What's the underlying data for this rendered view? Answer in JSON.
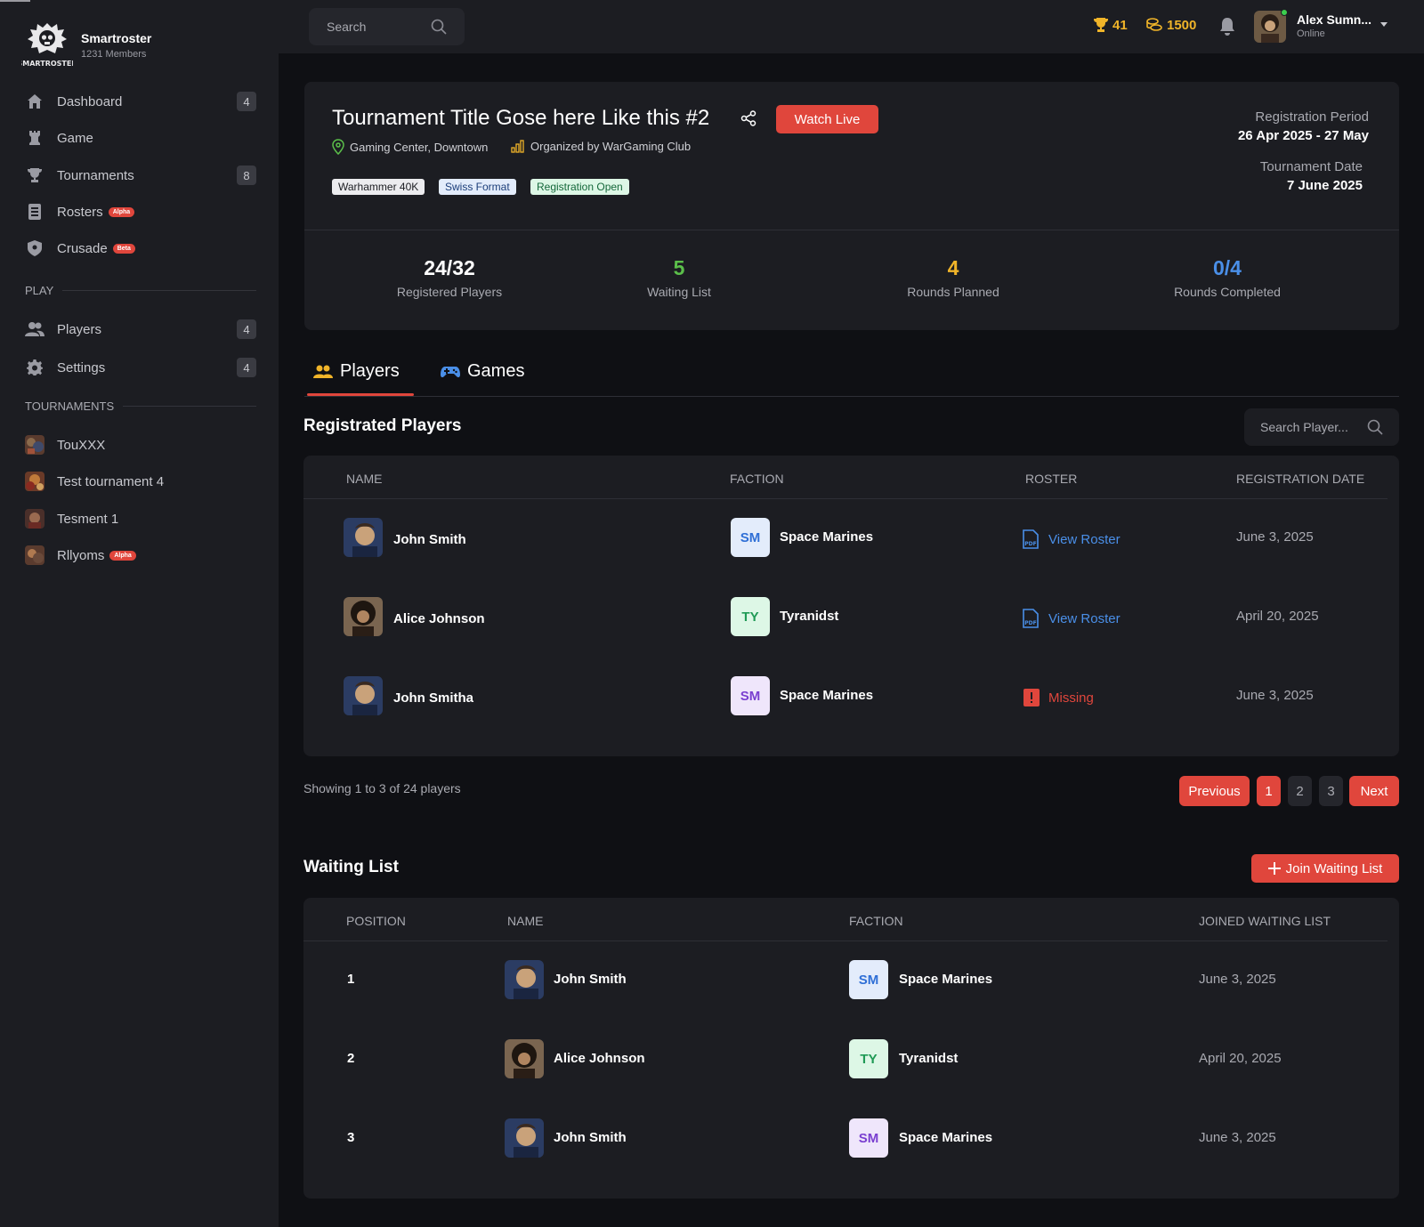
{
  "brand": {
    "name": "Smartroster",
    "members": "1231 Members",
    "logo_text": "SMARTROSTER"
  },
  "sidebar": {
    "items": [
      {
        "label": "Dashboard",
        "count": "4",
        "icon": "home-icon"
      },
      {
        "label": "Game",
        "icon": "chess-rook-icon"
      },
      {
        "label": "Tournaments",
        "count": "8",
        "icon": "trophy-icon"
      },
      {
        "label": "Rosters",
        "badge": "Alpha",
        "icon": "list-icon"
      },
      {
        "label": "Crusade",
        "badge": "Beta",
        "icon": "shield-icon"
      }
    ],
    "play_heading": "PLAY",
    "play_items": [
      {
        "label": "Players",
        "count": "4",
        "icon": "users-icon"
      },
      {
        "label": "Settings",
        "count": "4",
        "icon": "gear-icon"
      }
    ],
    "tournaments_heading": "TOURNAMENTS",
    "tournaments": [
      {
        "label": "TouXXX"
      },
      {
        "label": "Test tournament 4"
      },
      {
        "label": "Tesment 1"
      },
      {
        "label": "Rllyoms",
        "badge": "Alpha"
      }
    ]
  },
  "topbar": {
    "search_placeholder": "Search",
    "trophies": "41",
    "coins": "1500",
    "user_name": "Alex Sumn...",
    "user_status": "Online"
  },
  "tournament": {
    "title": "Tournament Title Gose here Like this #2",
    "watch_label": "Watch Live",
    "location": "Gaming Center, Downtown",
    "organizer": "Organized by WarGaming Club",
    "tags": [
      "Warhammer 40K",
      "Swiss Format",
      "Registration Open"
    ],
    "registration_period_label": "Registration Period",
    "registration_period": "26 Apr 2025 - 27 May",
    "tournament_date_label": "Tournament Date",
    "tournament_date": "7 June 2025",
    "stats": [
      {
        "value": "24/32",
        "label": "Registered Players",
        "color": "#ffffff"
      },
      {
        "value": "5",
        "label": "Waiting List",
        "color": "#5bbf4a"
      },
      {
        "value": "4",
        "label": "Rounds Planned",
        "color": "#f0b429"
      },
      {
        "value": "0/4",
        "label": "Rounds Completed",
        "color": "#4a8fe8"
      }
    ]
  },
  "tabs": [
    {
      "label": "Players",
      "active": true
    },
    {
      "label": "Games",
      "active": false
    }
  ],
  "registered": {
    "title": "Registrated Players",
    "search_placeholder": "Search Player...",
    "columns": [
      "NAME",
      "FACTION",
      "ROSTER",
      "REGISTRATION DATE"
    ],
    "rows": [
      {
        "name": "John Smith",
        "faction_code": "SM",
        "faction": "Space Marines",
        "roster": "View Roster",
        "roster_status": "ok",
        "date": "June 3, 2025"
      },
      {
        "name": "Alice Johnson",
        "faction_code": "TY",
        "faction": "Tyranidst",
        "roster": "View Roster",
        "roster_status": "ok",
        "date": "April 20, 2025"
      },
      {
        "name": "John Smitha",
        "faction_code": "SM",
        "faction": "Space Marines",
        "roster": "Missing",
        "roster_status": "missing",
        "date": "June 3, 2025"
      }
    ]
  },
  "pagination": {
    "showing": "Showing 1 to 3 of 24 players",
    "previous": "Previous",
    "pages": [
      "1",
      "2",
      "3"
    ],
    "current_page": "1",
    "next": "Next"
  },
  "waiting": {
    "title": "Waiting List",
    "join_label": "Join Waiting List",
    "columns": [
      "POSITION",
      "NAME",
      "FACTION",
      "JOINED WAITING LIST"
    ],
    "rows": [
      {
        "position": "1",
        "name": "John Smith",
        "faction_code": "SM",
        "faction": "Space Marines",
        "date": "June 3, 2025"
      },
      {
        "position": "2",
        "name": "Alice Johnson",
        "faction_code": "TY",
        "faction": "Tyranidst",
        "date": "April 20, 2025"
      },
      {
        "position": "3",
        "name": "John Smith",
        "faction_code": "SM",
        "faction": "Space Marines",
        "date": "June 3, 2025"
      }
    ]
  },
  "colors": {
    "accent": "#e0463c",
    "link": "#4a8fe8",
    "sm_blue_bg": "#e3ecfb",
    "sm_blue_fg": "#2f6fd6",
    "ty_bg": "#ddf7e6",
    "ty_fg": "#1f9a55",
    "sm_purple_bg": "#efe6fb",
    "sm_purple_fg": "#7a3fd0"
  }
}
